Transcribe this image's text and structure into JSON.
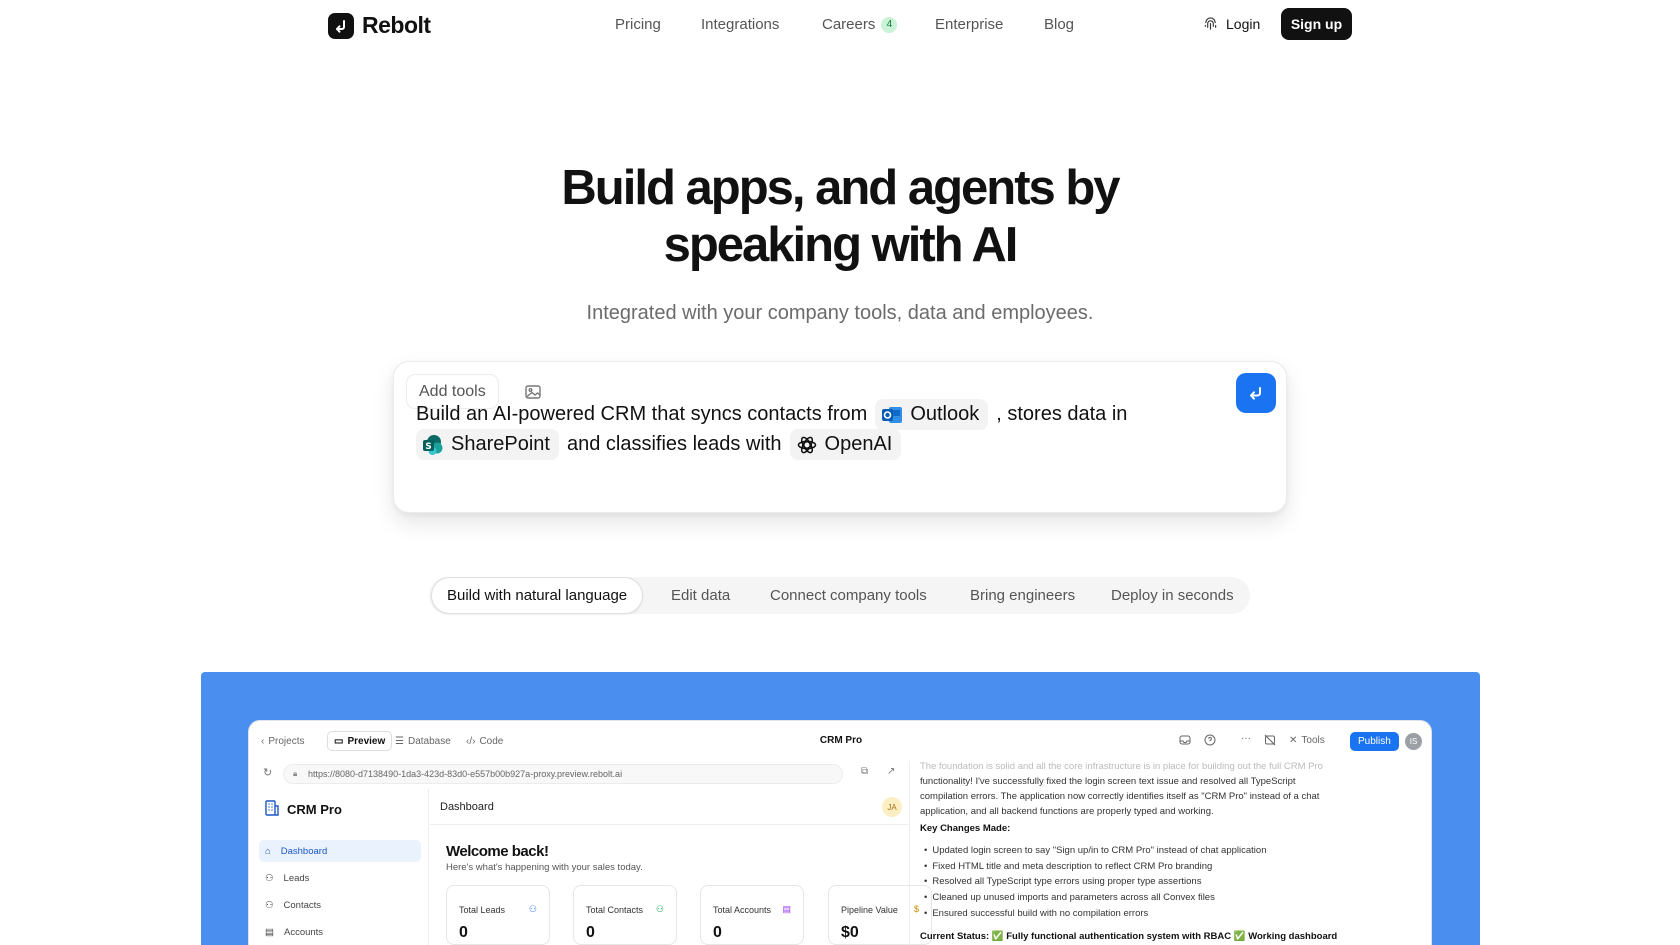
{
  "brand": {
    "name": "Rebolt"
  },
  "nav": {
    "links": [
      {
        "label": "Pricing"
      },
      {
        "label": "Integrations"
      },
      {
        "label": "Careers",
        "badge": "4"
      },
      {
        "label": "Enterprise"
      },
      {
        "label": "Blog"
      }
    ],
    "login": "Login",
    "signup": "Sign up"
  },
  "hero": {
    "title_line1": "Build apps, and agents by",
    "title_line2": "speaking with AI",
    "subtitle": "Integrated with your company tools, data and employees."
  },
  "prompt": {
    "add_tools": "Add tools",
    "seg1": "Build an AI-powered CRM that syncs contacts from",
    "chip_outlook": "Outlook",
    "seg2": ", stores data in",
    "chip_sharepoint": "SharePoint",
    "seg3": "and classifies leads with",
    "chip_openai": "OpenAI",
    "send_color": "#1a73f0"
  },
  "tabs": [
    {
      "label": "Build with natural language",
      "active": true
    },
    {
      "label": "Edit data"
    },
    {
      "label": "Connect company tools"
    },
    {
      "label": "Bring engineers"
    },
    {
      "label": "Deploy in seconds"
    }
  ],
  "showcase": {
    "bg_color": "#4a8ef0",
    "toolbar": {
      "back": "Projects",
      "preview": "Preview",
      "database": "Database",
      "code": "Code",
      "title": "CRM Pro",
      "tools": "Tools",
      "publish": "Publish",
      "avatar": "IS"
    },
    "url": "https://8080-d7138490-1da3-423d-83d0-e557b00b927a-proxy.preview.rebolt.ai",
    "sidebar": {
      "brand": "CRM Pro",
      "items": [
        {
          "label": "Dashboard",
          "active": true
        },
        {
          "label": "Leads"
        },
        {
          "label": "Contacts"
        },
        {
          "label": "Accounts"
        }
      ]
    },
    "main": {
      "header": "Dashboard",
      "avatar": "JA",
      "welcome": "Welcome back!",
      "welcome_sub": "Here's what's happening with your sales today.",
      "stats": [
        {
          "label": "Total Leads",
          "value": "0"
        },
        {
          "label": "Total Contacts",
          "value": "0"
        },
        {
          "label": "Total Accounts",
          "value": "0"
        },
        {
          "label": "Pipeline Value",
          "value": "$0"
        }
      ]
    },
    "chat": {
      "faded": "The foundation is solid and all the core infrastructure is in place for building out the full CRM Pro",
      "para": "functionality! I've successfully fixed the login screen text issue and resolved all TypeScript compilation errors. The application now correctly identifies itself as \"CRM Pro\" instead of a chat application, and all backend functions are properly typed and working.",
      "key_changes_title": "Key Changes Made:",
      "key_changes": [
        "Updated login screen to say \"Sign up/in to CRM Pro\" instead of chat application",
        "Fixed HTML title and meta description to reflect CRM Pro branding",
        "Resolved all TypeScript type errors using proper type assertions",
        "Cleaned up unused imports and parameters across all Convex files",
        "Ensured successful build with no compilation errors"
      ],
      "status": "Current Status: ✅ Fully functional authentication system with RBAC ✅ Working dashboard with"
    }
  }
}
